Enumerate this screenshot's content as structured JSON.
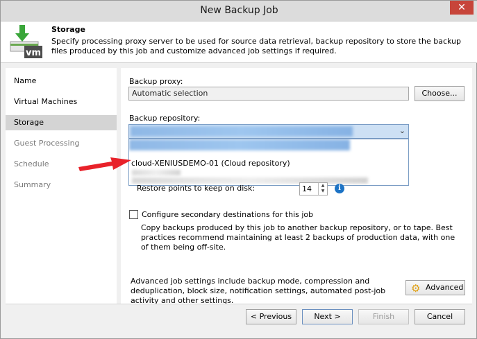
{
  "window": {
    "title": "New Backup Job",
    "close_glyph": "✕"
  },
  "header": {
    "title": "Storage",
    "description": "Specify processing proxy server to be used for source data retrieval, backup repository to store the backup files produced by this job and customize advanced job settings if required.",
    "icon": "vm-storage-icon",
    "icon_text": "vm"
  },
  "nav": {
    "items": [
      {
        "label": "Name"
      },
      {
        "label": "Virtual Machines"
      },
      {
        "label": "Storage"
      },
      {
        "label": "Guest Processing"
      },
      {
        "label": "Schedule"
      },
      {
        "label": "Summary"
      }
    ]
  },
  "storage": {
    "proxy_label": "Backup proxy:",
    "proxy_value": "Automatic selection",
    "choose_label": "Choose...",
    "repository_label": "Backup repository:",
    "repository_options": [
      {
        "label": "cloud-XENIUSDEMO-01 (Cloud repository)"
      }
    ],
    "restore_points_label": "Restore points to keep on disk:",
    "restore_points_value": "14",
    "secondary_label": "Configure secondary destinations for this job",
    "secondary_desc": "Copy backups produced by this job to another backup repository, or to tape. Best practices recommend maintaining at least 2 backups of production data, with one of them being off-site.",
    "advanced_desc": "Advanced job settings include backup mode, compression and deduplication, block size, notification settings, automated post-job activity and other settings.",
    "advanced_label": "Advanced"
  },
  "footer": {
    "previous_label": "< Previous",
    "next_label": "Next >",
    "finish_label": "Finish",
    "cancel_label": "Cancel"
  },
  "colors": {
    "arrow": "#e8222a",
    "selection": "#cde0f4",
    "info": "#1c73c5"
  }
}
